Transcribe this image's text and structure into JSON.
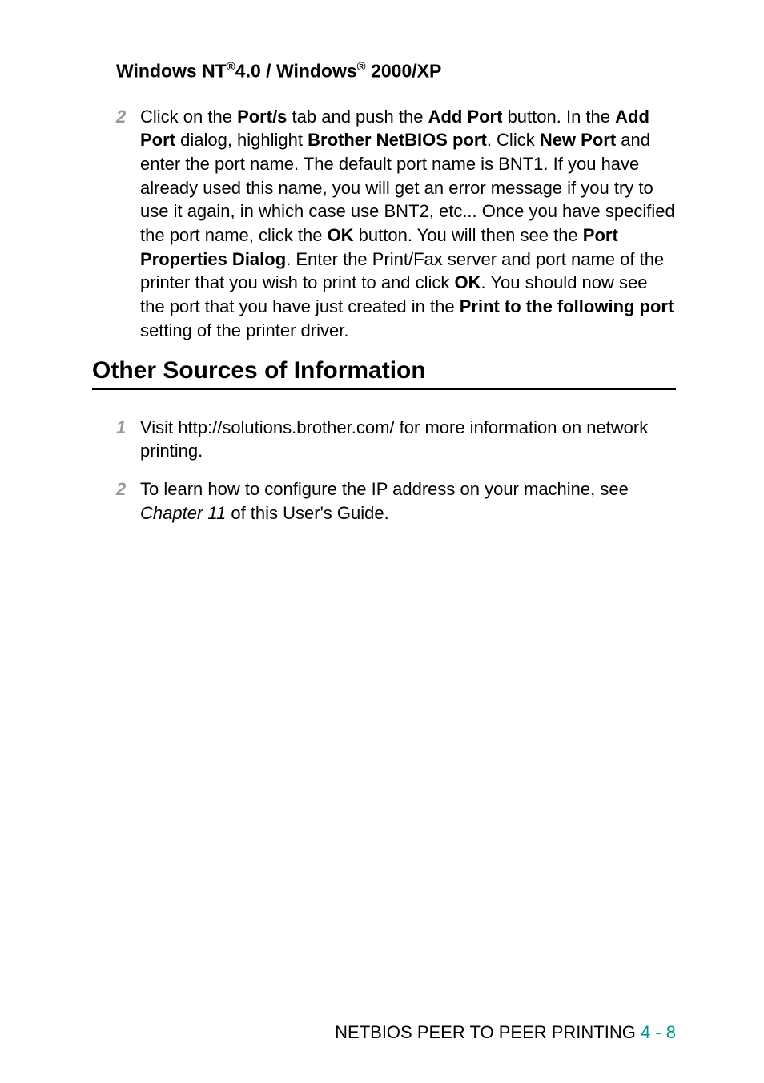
{
  "subsection": {
    "prefix": "Windows NT",
    "sup1": "®",
    "mid": "4.0 / Windows",
    "sup2": "®",
    "suffix": " 2000/XP"
  },
  "step2": {
    "number": "2",
    "t1": "Click on the ",
    "b1": "Port/s",
    "t2": " tab and push the ",
    "b2": "Add Port",
    "t3": " button. In the ",
    "b3": "Add Port",
    "t4": " dialog, highlight ",
    "b4": "Brother NetBIOS port",
    "t5": ". Click ",
    "b5": "New Port",
    "t6": " and enter the port name. The default port name is BNT1. If you have already used this name, you will get an error message if you try to use it again, in which case use BNT2, etc... Once you have specified the port name, click the ",
    "b6": "OK",
    "t7": " button. You will then see the ",
    "b7": "Port Properties Dialog",
    "t8": ". Enter the Print/Fax server and port name of the printer that you wish to print to and click ",
    "b8": "OK",
    "t9": ". You should now see the port that you have just created in the ",
    "b9": "Print to the following port",
    "t10": " setting of the printer driver."
  },
  "sectionHeading": "Other Sources of Information",
  "info1": {
    "number": "1",
    "t1": "Visit ",
    "link": "http://solutions.brother.com/",
    "t2": " for more information on network printing."
  },
  "info2": {
    "number": "2",
    "t1": "To learn how to configure the IP address on your machine, see ",
    "chapter": "Chapter 11",
    "t2": " of this User's Guide."
  },
  "footer": {
    "label": "NETBIOS PEER TO PEER PRINTING ",
    "page": "4 - 8"
  }
}
